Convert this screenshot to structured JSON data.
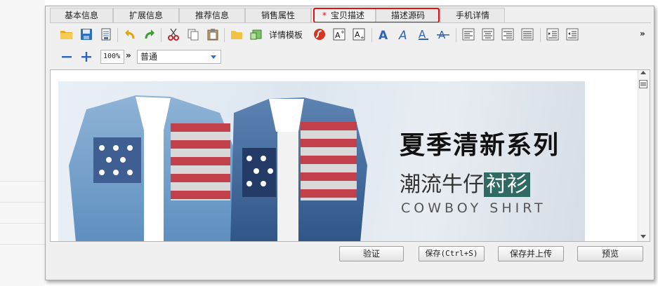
{
  "tabs": [
    {
      "label": "基本信息",
      "required": false
    },
    {
      "label": "扩展信息",
      "required": false
    },
    {
      "label": "推荐信息",
      "required": false
    },
    {
      "label": "销售属性",
      "required": false
    },
    {
      "label": "宝贝描述",
      "required": true,
      "marker": "*"
    },
    {
      "label": "描述源码",
      "required": false
    },
    {
      "label": "手机详情",
      "required": false
    }
  ],
  "toolbar": {
    "detail_template_label": "详情模板",
    "more_label": "»"
  },
  "format_bar": {
    "zoom_value": "100%",
    "zoom_more": "»",
    "format_value": "普通"
  },
  "banner": {
    "title": "夏季清新系列",
    "subtitle_plain": "潮流牛仔",
    "subtitle_highlight": "衬衫",
    "english": "COWBOY SHIRT",
    "highlight_color": "#2f6b62"
  },
  "buttons": {
    "verify": "验证",
    "save": "保存(Ctrl+S)",
    "save_upload": "保存并上传",
    "preview": "预览"
  }
}
